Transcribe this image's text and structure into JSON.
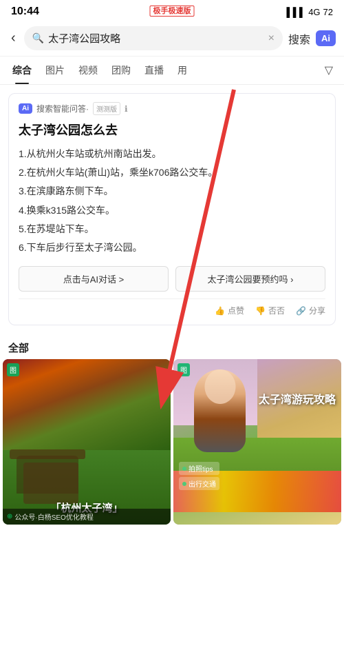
{
  "statusBar": {
    "time": "10:44",
    "logo": "极手极速版",
    "signal": "4G",
    "battery": "72"
  },
  "searchBar": {
    "query": "太子湾公园攻略",
    "searchLabel": "搜索",
    "aiLabel": "Ai",
    "backIcon": "‹",
    "clearIcon": "×",
    "searchIconChar": "🔍"
  },
  "tabs": {
    "items": [
      {
        "id": "comprehensive",
        "label": "综合",
        "active": true
      },
      {
        "id": "images",
        "label": "图片",
        "active": false
      },
      {
        "id": "videos",
        "label": "视频",
        "active": false
      },
      {
        "id": "groupbuy",
        "label": "团购",
        "active": false
      },
      {
        "id": "live",
        "label": "直播",
        "active": false
      },
      {
        "id": "more",
        "label": "用",
        "active": false
      }
    ],
    "filterIcon": "▼"
  },
  "aiCard": {
    "badgeLabel": "Ai",
    "headerText": "搜索智能问答·测测版",
    "betaLabel": "测测版",
    "infoIcon": "ℹ",
    "question": "太子湾公园怎么去",
    "steps": [
      "1.从杭州火车站或杭州南站出发。",
      "2.在杭州火车站(萧山)站，乘坐k706路公交车。",
      "3.在滨康路东侧下车。",
      "4.换乘k315路公交车。",
      "5.在苏堤站下车。",
      "6.下车后步行至太子湾公园。"
    ],
    "actionBtn1": "点击与AI对话 >",
    "actionBtn2": "太子湾公园要预约吗 ›",
    "feedbackItems": [
      {
        "icon": "👍",
        "label": "点赞"
      },
      {
        "icon": "👎",
        "label": "否否"
      },
      {
        "icon": "🔗",
        "label": "分享"
      }
    ]
  },
  "resultsSection": {
    "label": "全部",
    "cards": [
      {
        "id": "card1",
        "icon": "图",
        "title": "「杭州太子湾」",
        "bottomText": "公众号·白杨SEO优化教程"
      },
      {
        "id": "card2",
        "icon": "图",
        "title": "太子湾游玩攻略",
        "tags": [
          "拍照tips",
          "出行交通"
        ],
        "bottomText": ""
      }
    ]
  }
}
